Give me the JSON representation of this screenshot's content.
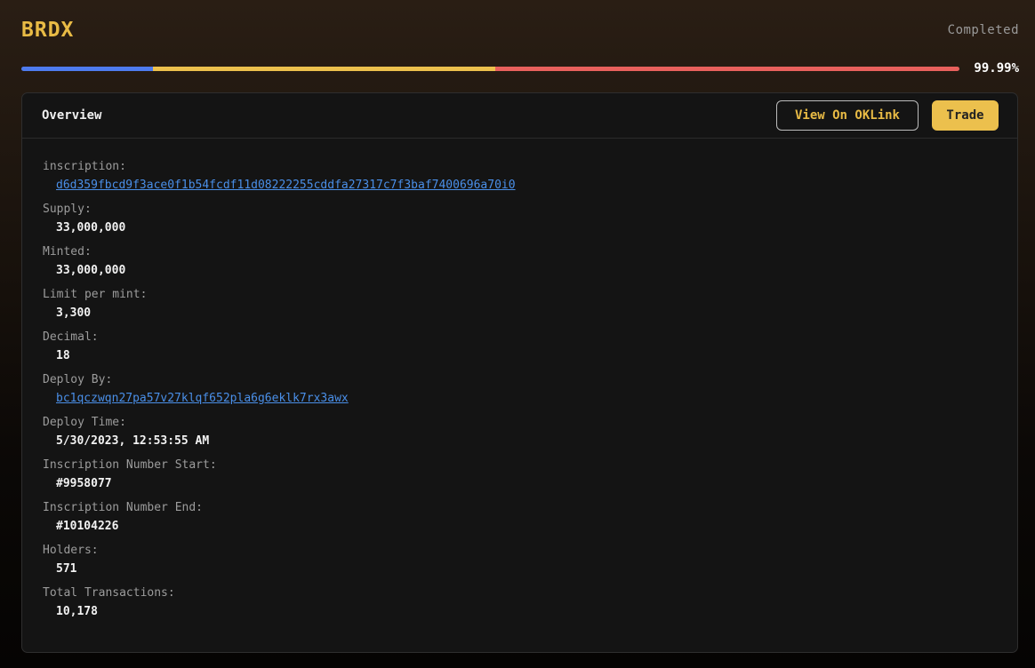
{
  "header": {
    "ticker": "BRDX",
    "status": "Completed"
  },
  "progress": {
    "percent_label": "99.99%",
    "percent": 99.99,
    "segments": [
      {
        "name": "blue",
        "fraction": 0.14,
        "color": "#4e7bee"
      },
      {
        "name": "yellow",
        "fraction": 0.365,
        "color": "#ecc04d"
      },
      {
        "name": "red",
        "fraction": 0.495,
        "color": "#e8605c"
      }
    ]
  },
  "card": {
    "title": "Overview",
    "view_button": "View On OKLink",
    "trade_button": "Trade"
  },
  "fields": [
    {
      "label": "inscription:",
      "value": "d6d359fbcd9f3ace0f1b54fcdf11d08222255cddfa27317c7f3baf7400696a70i0",
      "link": true
    },
    {
      "label": "Supply:",
      "value": "33,000,000",
      "link": false
    },
    {
      "label": "Minted:",
      "value": "33,000,000",
      "link": false
    },
    {
      "label": "Limit per mint:",
      "value": "3,300",
      "link": false
    },
    {
      "label": "Decimal:",
      "value": "18",
      "link": false
    },
    {
      "label": "Deploy By:",
      "value": "bc1qczwqn27pa57v27klqf652pla6g6eklk7rx3awx",
      "link": true
    },
    {
      "label": "Deploy Time:",
      "value": "5/30/2023, 12:53:55 AM",
      "link": false
    },
    {
      "label": "Inscription Number Start:",
      "value": "#9958077",
      "link": false
    },
    {
      "label": "Inscription Number End:",
      "value": "#10104226",
      "link": false
    },
    {
      "label": "Holders:",
      "value": "571",
      "link": false
    },
    {
      "label": "Total Transactions:",
      "value": "10,178",
      "link": false
    }
  ],
  "colors": {
    "accent": "#e9bb45",
    "link": "#4a8fe8",
    "card_bg": "#141414"
  }
}
